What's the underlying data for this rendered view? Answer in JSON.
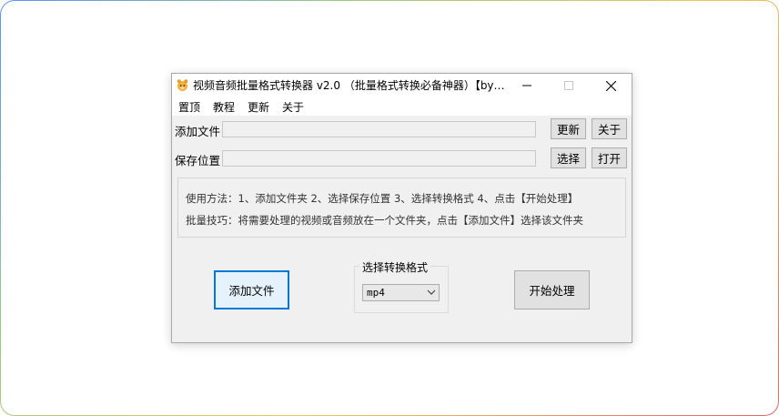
{
  "window": {
    "title": "视频音频批量格式转换器 v2.0 （批量格式转换必备神器）【by…"
  },
  "menu": {
    "items": [
      "置顶",
      "教程",
      "更新",
      "关于"
    ]
  },
  "form": {
    "add_file_label": "添加文件",
    "save_location_label": "保存位置",
    "add_file_value": "",
    "save_location_value": "",
    "update_button": "更新",
    "about_button": "关于",
    "choose_button": "选择",
    "open_button": "打开"
  },
  "info": {
    "usage": "使用方法：1、添加文件夹  2、选择保存位置  3、选择转换格式  4、点击【开始处理】",
    "tip": "批量技巧：将需要处理的视频或音频放在一个文件夹，点击【添加文件】选择该文件夹"
  },
  "actions": {
    "add_file_button": "添加文件",
    "format_group_title": "选择转换格式",
    "format_selected": "mp4",
    "start_button": "开始处理"
  },
  "icons": {
    "app": "app-icon",
    "minimize": "minimize-icon",
    "maximize": "maximize-icon",
    "close": "close-icon",
    "dropdown": "chevron-down-icon"
  },
  "colors": {
    "focus_border": "#0078d7",
    "button_face": "#e1e1e1",
    "window_bg": "#f0f0f0"
  }
}
